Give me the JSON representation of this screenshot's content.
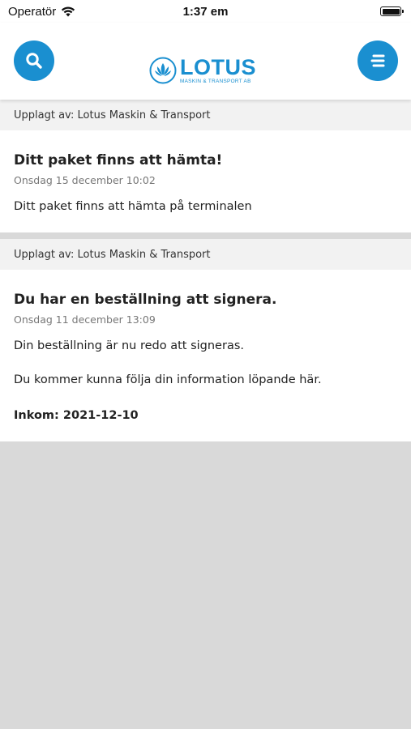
{
  "status_bar": {
    "carrier": "Operatör",
    "time": "1:37 em",
    "battery_level": 1.0
  },
  "header": {
    "logo": {
      "name": "LOTUS",
      "tagline": "MASKIN & TRANSPORT AB"
    },
    "search_icon": "search-icon",
    "menu_icon": "menu-icon",
    "accent_color": "#1a8fd0"
  },
  "posts": [
    {
      "posted_by": "Upplagt av: Lotus Maskin & Transport",
      "title": "Ditt paket finns att hämta!",
      "date": "Onsdag 15 december 10:02",
      "paragraphs": [
        "Ditt paket finns att hämta på terminalen"
      ]
    },
    {
      "posted_by": "Upplagt av: Lotus Maskin & Transport",
      "title": "Du har en beställning att signera.",
      "date": "Onsdag 11 december 13:09",
      "paragraphs": [
        "Din beställning är nu redo att signeras.",
        "Du kommer kunna följa din information löpande här."
      ],
      "footer": "Inkom: 2021-12-10"
    }
  ]
}
